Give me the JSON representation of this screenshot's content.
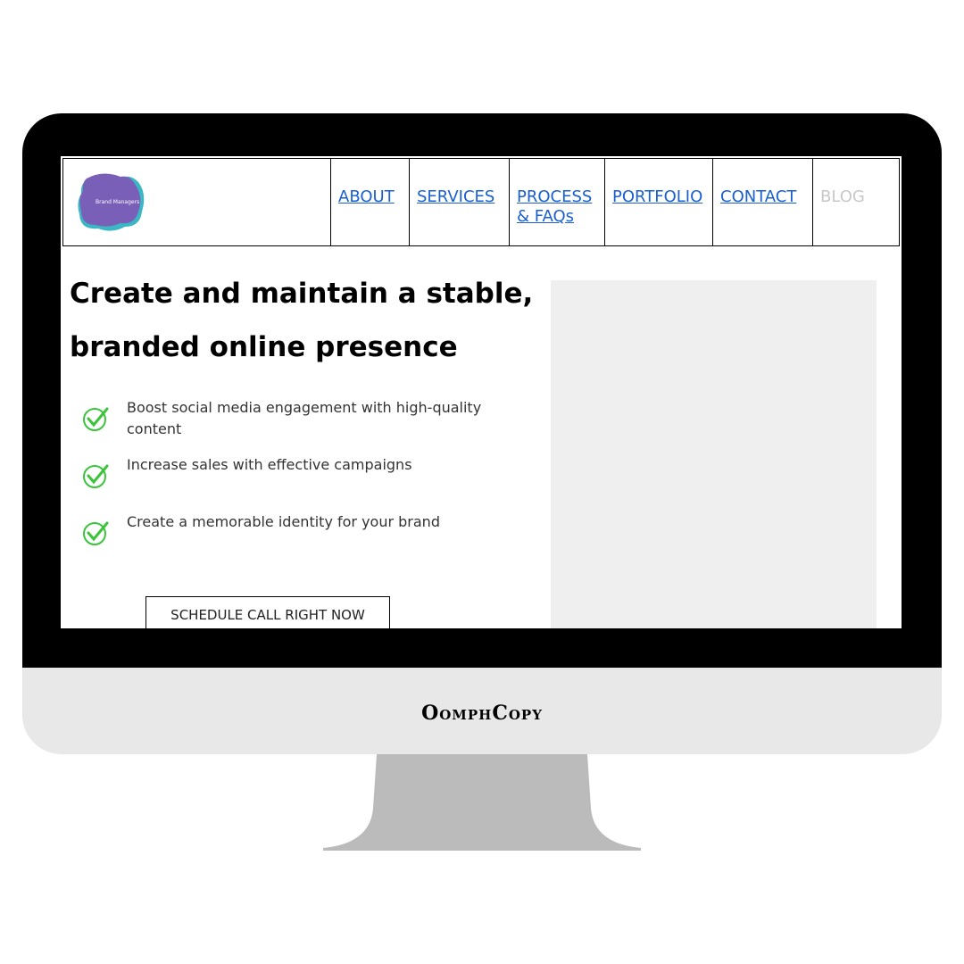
{
  "logo": {
    "text": "Brand Managers",
    "colors": [
      "#7a5fb8",
      "#3ab6c4"
    ]
  },
  "nav": [
    {
      "label": "ABOUT",
      "width": 88
    },
    {
      "label": "SERVICES",
      "width": 112
    },
    {
      "label": "PROCESS & FAQs",
      "width": 107
    },
    {
      "label": "PORTFOLIO",
      "width": 121
    },
    {
      "label": "CONTACT",
      "width": 112
    },
    {
      "label": "BLOG",
      "width": 97,
      "inactive": true
    }
  ],
  "hero": {
    "title": "Create and maintain a stable, branded online presence",
    "bullets": [
      "Boost social media engagement with high-quality content",
      "Increase sales with effective campaigns",
      "Create a memorable identity for your brand"
    ],
    "cta": "SCHEDULE CALL RIGHT NOW"
  },
  "monitor": {
    "brand": "OomphCopy"
  },
  "colors": {
    "link": "#1a5fd0",
    "check": "#3bc43b",
    "bezel": "#000000",
    "chin": "#e8e8e8",
    "stand": "#bbbbbb"
  }
}
